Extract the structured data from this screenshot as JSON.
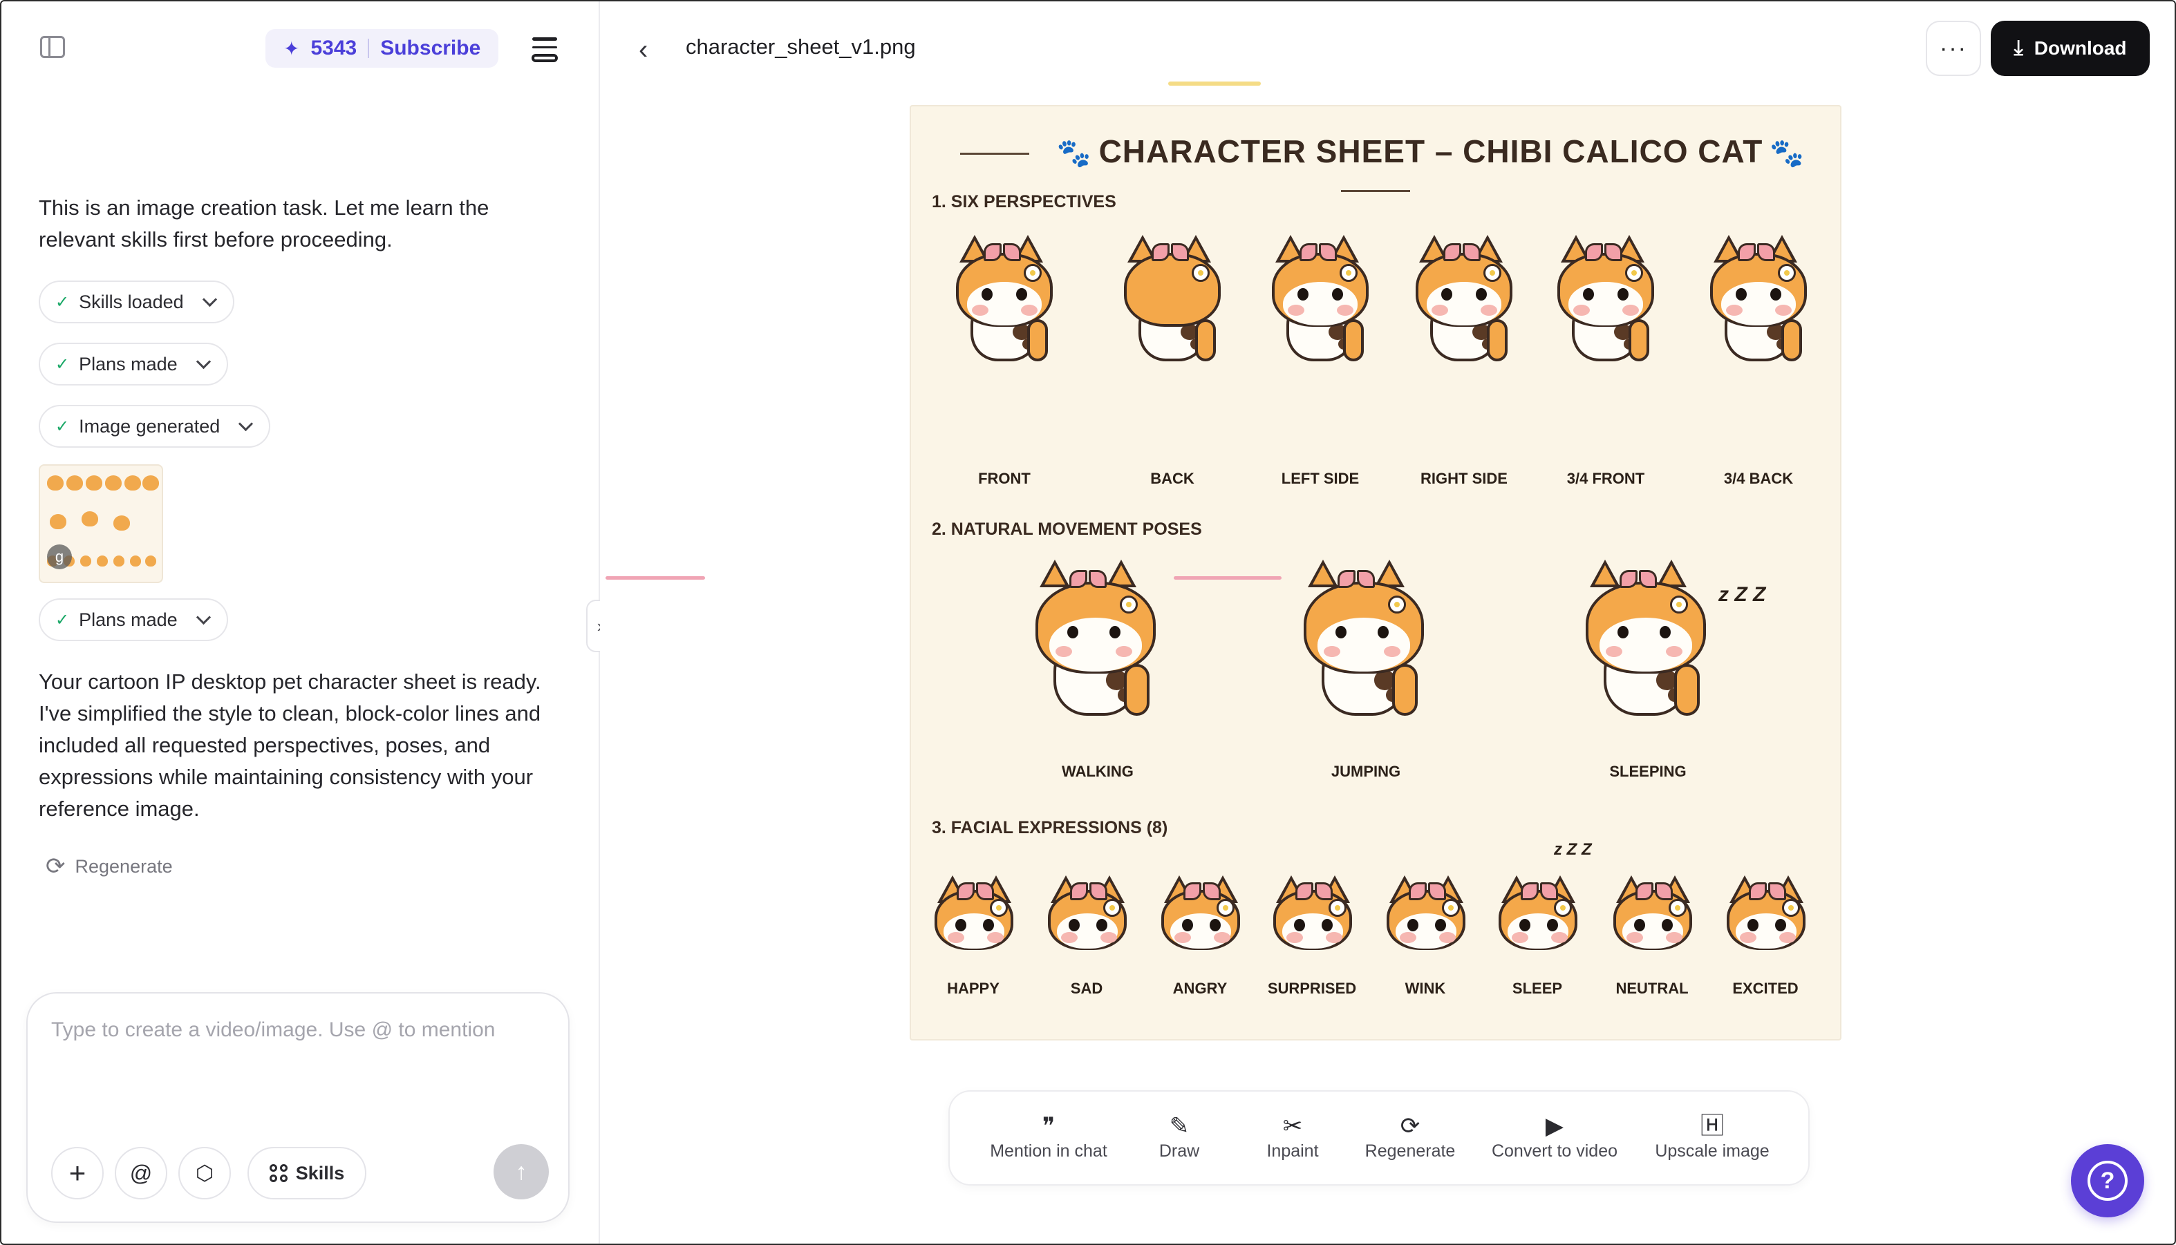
{
  "header": {
    "credits_value": "5343",
    "subscribe_label": "Subscribe"
  },
  "chat": {
    "intro": "This is an image creation task. Let me learn the relevant skills first before proceeding.",
    "chips": {
      "skills": "Skills loaded",
      "plans1": "Plans made",
      "image": "Image generated",
      "plans2": "Plans made"
    },
    "thumb_badge": "g",
    "result": "Your cartoon IP desktop pet character sheet is ready. I've simplified the style to clean, block-color lines and included all requested perspectives, poses, and expressions while maintaining consistency with your reference image.",
    "regenerate_label": "Regenerate"
  },
  "composer": {
    "placeholder": "Type to create a video/image. Use @ to mention",
    "at_symbol": "@",
    "skills_label": "Skills"
  },
  "viewer": {
    "filename": "character_sheet_v1.png",
    "download_label": "Download",
    "more_label": "···"
  },
  "sheet": {
    "title": "CHARACTER SHEET – CHIBI CALICO CAT",
    "sections": {
      "perspectives": "1. SIX PERSPECTIVES",
      "poses": "2. NATURAL MOVEMENT POSES",
      "expressions": "3. FACIAL EXPRESSIONS (8)"
    },
    "perspectives": [
      "FRONT",
      "BACK",
      "LEFT SIDE",
      "RIGHT SIDE",
      "3/4 FRONT",
      "3/4 BACK"
    ],
    "poses": [
      "WALKING",
      "JUMPING",
      "SLEEPING"
    ],
    "expressions": [
      "HAPPY",
      "SAD",
      "ANGRY",
      "SURPRISED",
      "WINK",
      "SLEEP",
      "NEUTRAL",
      "EXCITED"
    ],
    "zzz": "z Z Z"
  },
  "toolbar": {
    "mention": "Mention in chat",
    "draw": "Draw",
    "inpaint": "Inpaint",
    "regenerate": "Regenerate",
    "convert": "Convert to video",
    "upscale": "Upscale image"
  },
  "colors": {
    "accent": "#4b3fd9",
    "help_button": "#5b3fd6",
    "success_check": "#1aa867",
    "cat_orange": "#f4a84a",
    "sheet_bg": "#fbf5e7"
  }
}
